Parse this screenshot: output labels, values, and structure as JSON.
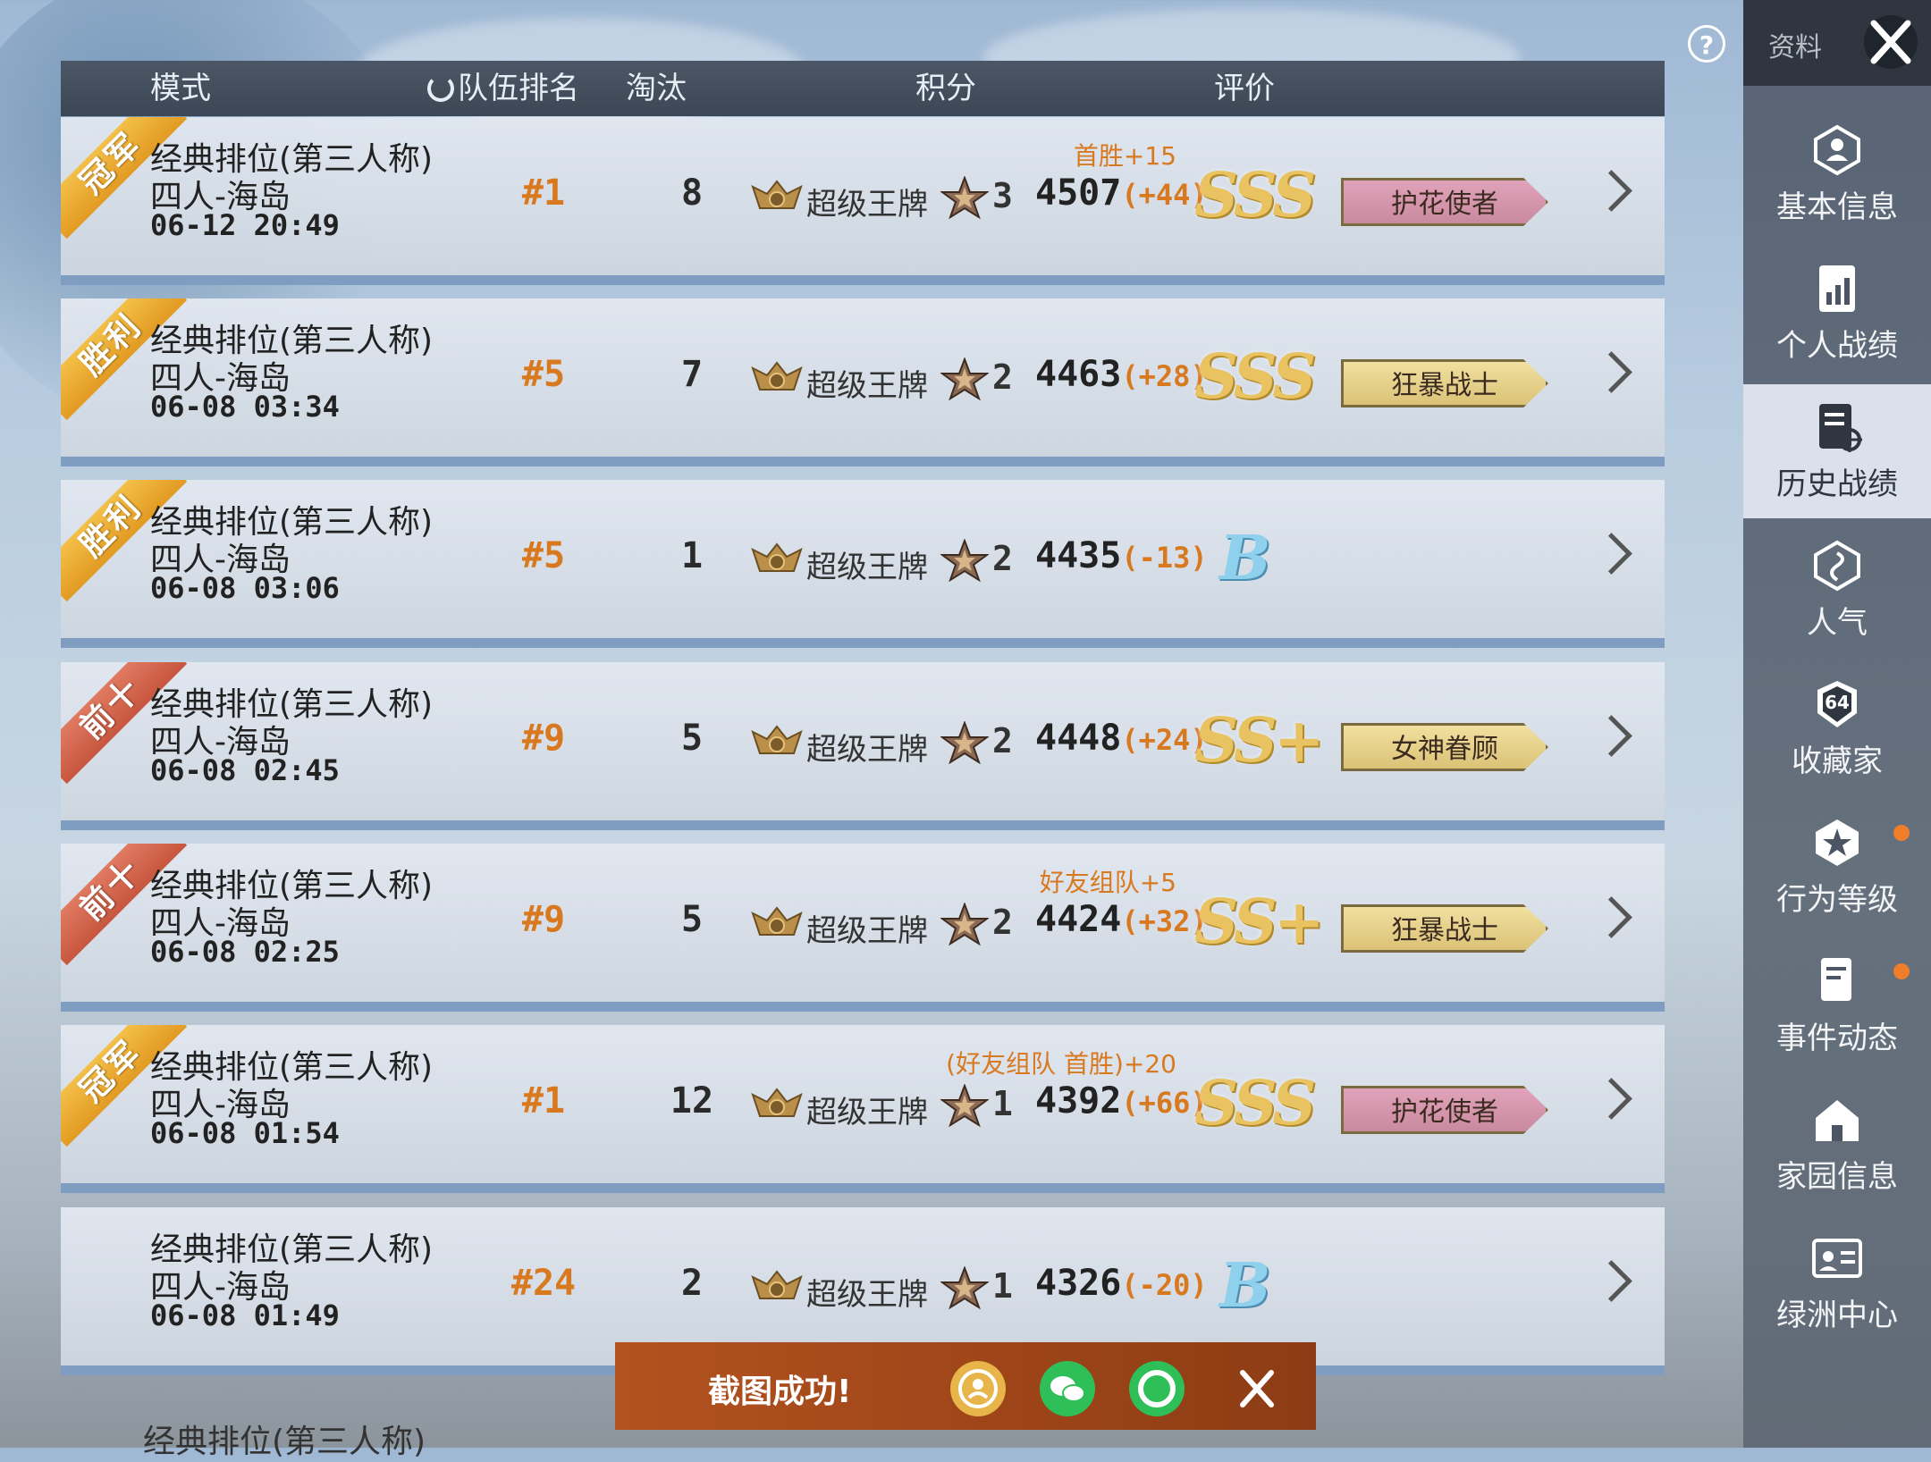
{
  "header": {
    "mode": "模式",
    "team_rank": "队伍排名",
    "eliminations": "淘汰",
    "score": "积分",
    "evaluation": "评价"
  },
  "matches": [
    {
      "ribbon": "冠军",
      "ribbon_color": "gold",
      "mode": "经典排位(第三人称)",
      "map": "四人-海岛",
      "time": "06-12 20:49",
      "rank": "#1",
      "elims": "8",
      "tier": "超级王牌",
      "stars": "3",
      "score": "4507",
      "delta": "(+44)",
      "bonus": "首胜+15",
      "eval": "SSS",
      "title": "护花使者",
      "title_color": "pink"
    },
    {
      "ribbon": "胜利",
      "ribbon_color": "gold",
      "mode": "经典排位(第三人称)",
      "map": "四人-海岛",
      "time": "06-08 03:34",
      "rank": "#5",
      "elims": "7",
      "tier": "超级王牌",
      "stars": "2",
      "score": "4463",
      "delta": "(+28)",
      "bonus": "",
      "eval": "SSS",
      "title": "狂暴战士",
      "title_color": "gold"
    },
    {
      "ribbon": "胜利",
      "ribbon_color": "gold",
      "mode": "经典排位(第三人称)",
      "map": "四人-海岛",
      "time": "06-08 03:06",
      "rank": "#5",
      "elims": "1",
      "tier": "超级王牌",
      "stars": "2",
      "score": "4435",
      "delta": "(-13)",
      "bonus": "",
      "eval": "B",
      "title": "",
      "title_color": ""
    },
    {
      "ribbon": "前十",
      "ribbon_color": "red",
      "mode": "经典排位(第三人称)",
      "map": "四人-海岛",
      "time": "06-08 02:45",
      "rank": "#9",
      "elims": "5",
      "tier": "超级王牌",
      "stars": "2",
      "score": "4448",
      "delta": "(+24)",
      "bonus": "",
      "eval": "SS+",
      "title": "女神眷顾",
      "title_color": "gold"
    },
    {
      "ribbon": "前十",
      "ribbon_color": "red",
      "mode": "经典排位(第三人称)",
      "map": "四人-海岛",
      "time": "06-08 02:25",
      "rank": "#9",
      "elims": "5",
      "tier": "超级王牌",
      "stars": "2",
      "score": "4424",
      "delta": "(+32)",
      "bonus": "好友组队+5",
      "eval": "SS+",
      "title": "狂暴战士",
      "title_color": "gold"
    },
    {
      "ribbon": "冠军",
      "ribbon_color": "gold",
      "mode": "经典排位(第三人称)",
      "map": "四人-海岛",
      "time": "06-08 01:54",
      "rank": "#1",
      "elims": "12",
      "tier": "超级王牌",
      "stars": "1",
      "score": "4392",
      "delta": "(+66)",
      "bonus": "(好友组队 首胜)+20",
      "eval": "SSS",
      "title": "护花使者",
      "title_color": "pink"
    },
    {
      "ribbon": "",
      "ribbon_color": "",
      "mode": "经典排位(第三人称)",
      "map": "四人-海岛",
      "time": "06-08 01:49",
      "rank": "#24",
      "elims": "2",
      "tier": "超级王牌",
      "stars": "1",
      "score": "4326",
      "delta": "(-20)",
      "bonus": "",
      "eval": "B",
      "title": "",
      "title_color": ""
    }
  ],
  "peek_row_mode": "经典排位(第三人称)",
  "sidebar": {
    "tab": "资料",
    "items": [
      {
        "label": "基本信息",
        "icon": "person-badge-icon",
        "active": false,
        "dot": false
      },
      {
        "label": "个人战绩",
        "icon": "stats-doc-icon",
        "active": false,
        "dot": false
      },
      {
        "label": "历史战绩",
        "icon": "history-doc-icon",
        "active": true,
        "dot": false
      },
      {
        "label": "人气",
        "icon": "popularity-icon",
        "active": false,
        "dot": false
      },
      {
        "label": "收藏家",
        "icon": "collector-badge-icon",
        "active": false,
        "dot": false
      },
      {
        "label": "行为等级",
        "icon": "behavior-shield-icon",
        "active": false,
        "dot": true
      },
      {
        "label": "事件动态",
        "icon": "event-doc-icon",
        "active": false,
        "dot": true
      },
      {
        "label": "家园信息",
        "icon": "home-icon",
        "active": false,
        "dot": false
      },
      {
        "label": "绿洲中心",
        "icon": "oasis-id-icon",
        "active": false,
        "dot": false
      }
    ],
    "collector_level": "64"
  },
  "toast": {
    "text": "截图成功!",
    "buttons": [
      "qq-share-icon",
      "wechat-share-icon",
      "moments-share-icon",
      "close-icon"
    ]
  },
  "colors": {
    "accent_orange": "#d9791f",
    "row_separator": "#7f9cc1",
    "header_bg": "#3c4755",
    "sidebar_bg": "#4b5564"
  }
}
